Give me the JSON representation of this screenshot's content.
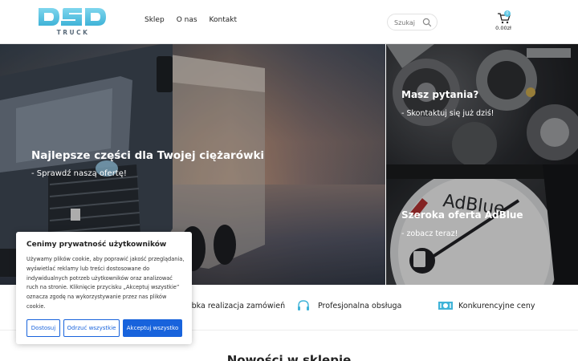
{
  "header": {
    "logo_word": "DSD",
    "logo_sub": "TRUCK",
    "nav": [
      "Sklep",
      "O nas",
      "Kontakt"
    ],
    "search_placeholder": "Szukaj",
    "cart_count": "0",
    "cart_total": "0.00zł"
  },
  "hero": {
    "main_title": "Najlepsze części dla Twojej ciężarówki",
    "main_sub": "- Sprawdź naszą ofertę!",
    "panel_a_title": "Masz pytania?",
    "panel_a_sub": "- Skontaktuj się już dziś!",
    "panel_b_title": "Szeroka oferta AdBlue",
    "panel_b_sub": "- zobacz teraz!",
    "panel_b_badge": "AdBlue"
  },
  "features": [
    {
      "icon": "truck-icon",
      "label": "Szybka realizacja zamówień"
    },
    {
      "icon": "headset-icon",
      "label": "Profesjonalna obsługa"
    },
    {
      "icon": "money-icon",
      "label": "Konkurencyjne ceny"
    }
  ],
  "section_title": "Nowości w sklepie",
  "cookie": {
    "title": "Cenimy prywatność użytkowników",
    "text": "Używamy plików cookie, aby poprawić jakość przeglądania, wyświetlać reklamy lub treści dostosowane do indywidualnych potrzeb użytkowników oraz analizować ruch na stronie. Kliknięcie przycisku „Akceptuj wszystkie” oznacza zgodę na wykorzystywanie przez nas plików cookie.",
    "btn_customize": "Dostosuj",
    "btn_reject": "Odrzuć wszystkie",
    "btn_accept": "Akceptuj wszystko"
  },
  "colors": {
    "accent": "#1863dc",
    "logo": "#5ec7e4"
  }
}
